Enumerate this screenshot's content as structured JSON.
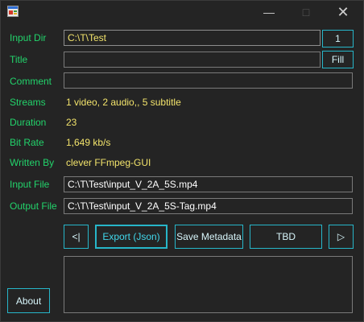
{
  "window": {
    "controls": {
      "minimize": "—",
      "maximize": "□",
      "close": "✕"
    }
  },
  "fields": {
    "input_dir": {
      "label": "Input Dir",
      "value": "C:\\T\\Test",
      "button": "1"
    },
    "title": {
      "label": "Title",
      "value": "",
      "button": "Fill"
    },
    "comment": {
      "label": "Comment",
      "value": ""
    },
    "streams": {
      "label": "Streams",
      "value": "1 video, 2 audio,, 5 subtitle"
    },
    "duration": {
      "label": "Duration",
      "value": "23"
    },
    "bit_rate": {
      "label": "Bit Rate",
      "value": "1,649 kb/s"
    },
    "written_by": {
      "label": "Written By",
      "value": "clever FFmpeg-GUI"
    },
    "input_file": {
      "label": "Input File",
      "value": "C:\\T\\Test\\input_V_2A_5S.mp4"
    },
    "output_file": {
      "label": "Output File",
      "value": "C:\\T\\Test\\input_V_2A_5S-Tag.mp4"
    }
  },
  "actions": {
    "prev": "<|",
    "export": "Export (Json)",
    "save_metadata": "Save Metadata",
    "tbd": "TBD",
    "next": "▷",
    "about": "About"
  },
  "colors": {
    "background": "#242424",
    "label": "#22d36b",
    "value": "#f2e36b",
    "button_border": "#27b6c9",
    "button_text": "#41d8ec"
  }
}
